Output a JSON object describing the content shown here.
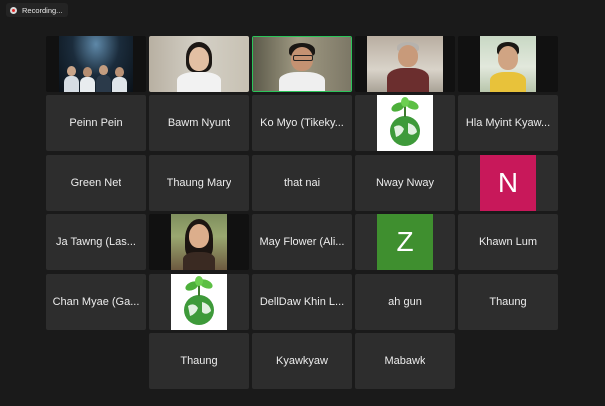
{
  "status": {
    "recording_label": "Recording..."
  },
  "colors": {
    "active_speaker": "#2cc45a",
    "avatar_n": "#c8185a",
    "avatar_z": "#3f8f2f",
    "recording_dot": "#e02828"
  },
  "participants": [
    {
      "name": "",
      "type": "video",
      "scene": "stage-group"
    },
    {
      "name": "",
      "type": "video",
      "scene": "woman-room"
    },
    {
      "name": "",
      "type": "video",
      "scene": "man-glasses",
      "active_speaker": true
    },
    {
      "name": "",
      "type": "video",
      "scene": "older-man"
    },
    {
      "name": "",
      "type": "video",
      "scene": "young-man"
    },
    {
      "name": "Peinn Pein",
      "type": "name"
    },
    {
      "name": "Bawm Nyunt",
      "type": "name"
    },
    {
      "name": "Ko Myo (Tikeky...",
      "type": "name"
    },
    {
      "name": "",
      "type": "image",
      "icon": "green-earth-icon"
    },
    {
      "name": "Hla Myint Kyaw...",
      "type": "name"
    },
    {
      "name": "Green Net",
      "type": "name"
    },
    {
      "name": "Thaung Mary",
      "type": "name"
    },
    {
      "name": "that nai",
      "type": "name"
    },
    {
      "name": "Nway Nway",
      "type": "name"
    },
    {
      "name": "",
      "type": "letter",
      "letter": "N"
    },
    {
      "name": "Ja Tawng (Las...",
      "type": "name"
    },
    {
      "name": "",
      "type": "video",
      "scene": "woman-outdoor"
    },
    {
      "name": "May Flower (Ali...",
      "type": "name"
    },
    {
      "name": "",
      "type": "letter",
      "letter": "Z"
    },
    {
      "name": "Khawn Lum",
      "type": "name"
    },
    {
      "name": "Chan Myae (Ga...",
      "type": "name"
    },
    {
      "name": "",
      "type": "image",
      "icon": "green-earth-icon"
    },
    {
      "name": "DellDaw Khin L...",
      "type": "name"
    },
    {
      "name": "ah gun",
      "type": "name"
    },
    {
      "name": "Thaung",
      "type": "name"
    },
    {
      "name": "Thaung",
      "type": "name"
    },
    {
      "name": "Kyawkyaw",
      "type": "name"
    },
    {
      "name": "Mabawk",
      "type": "name"
    }
  ]
}
